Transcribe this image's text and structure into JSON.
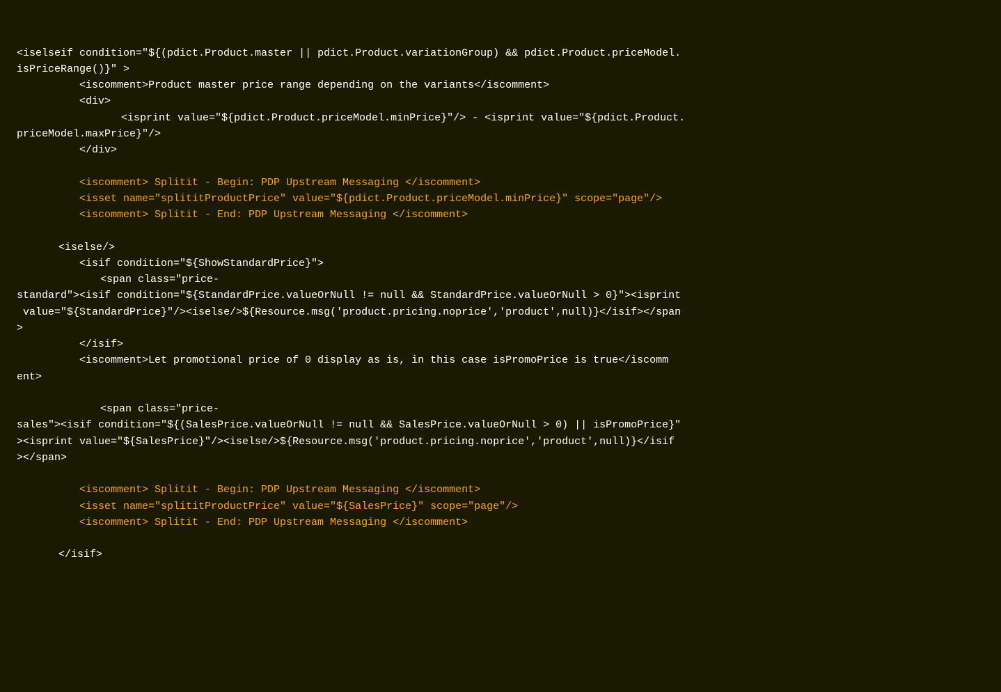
{
  "code": {
    "lines": [
      {
        "indent": 0,
        "color": "white",
        "text": "<iselseif condition=\"${(pdict.Product.master || pdict.Product.variationGroup) && pdict.Product.priceModel."
      },
      {
        "indent": 0,
        "color": "white",
        "text": "isPriceRange()}\" >"
      },
      {
        "indent": 3,
        "color": "white",
        "text": "<iscomment>Product master price range depending on the variants</iscomment>"
      },
      {
        "indent": 3,
        "color": "white",
        "text": "<div>"
      },
      {
        "indent": 5,
        "color": "white",
        "text": "<isprint value=\"${pdict.Product.priceModel.minPrice}\"/> - <isprint value=\"${pdict.Product."
      },
      {
        "indent": 0,
        "color": "white",
        "text": "priceModel.maxPrice}\"/>"
      },
      {
        "indent": 3,
        "color": "white",
        "text": "</div>"
      },
      {
        "indent": 0,
        "color": "blank",
        "text": ""
      },
      {
        "indent": 3,
        "color": "orange",
        "text": "<iscomment> Splitit - Begin: PDP Upstream Messaging </iscomment>"
      },
      {
        "indent": 3,
        "color": "orange",
        "text": "<isset name=\"splititProductPrice\" value=\"${pdict.Product.priceModel.minPrice}\" scope=\"page\"/>"
      },
      {
        "indent": 3,
        "color": "orange",
        "text": "<iscomment> Splitit - End: PDP Upstream Messaging </iscomment>"
      },
      {
        "indent": 0,
        "color": "blank",
        "text": ""
      },
      {
        "indent": 2,
        "color": "white",
        "text": "<iselse/>"
      },
      {
        "indent": 3,
        "color": "white",
        "text": "<isif condition=\"${ShowStandardPrice}\">"
      },
      {
        "indent": 4,
        "color": "white",
        "text": "<span class=\"price-"
      },
      {
        "indent": 0,
        "color": "white",
        "text": "standard\"><isif condition=\"${StandardPrice.valueOrNull != null && StandardPrice.valueOrNull > 0}\"><isprint"
      },
      {
        "indent": 0,
        "color": "white",
        "text": " value=\"${StandardPrice}\"/><iselse/>${Resource.msg('product.pricing.noprice','product',null)}</isif></span"
      },
      {
        "indent": 0,
        "color": "white",
        "text": ">"
      },
      {
        "indent": 3,
        "color": "white",
        "text": "</isif>"
      },
      {
        "indent": 3,
        "color": "white",
        "text": "<iscomment>Let promotional price of 0 display as is, in this case isPromoPrice is true</iscomm"
      },
      {
        "indent": 0,
        "color": "white",
        "text": "ent>"
      },
      {
        "indent": 0,
        "color": "blank",
        "text": ""
      },
      {
        "indent": 4,
        "color": "white",
        "text": "<span class=\"price-"
      },
      {
        "indent": 0,
        "color": "white",
        "text": "sales\"><isif condition=\"${(SalesPrice.valueOrNull != null && SalesPrice.valueOrNull > 0) || isPromoPrice}\""
      },
      {
        "indent": 0,
        "color": "white",
        "text": "><isprint value=\"${SalesPrice}\"/><iselse/>${Resource.msg('product.pricing.noprice','product',null)}</isif"
      },
      {
        "indent": 0,
        "color": "white",
        "text": "></span>"
      },
      {
        "indent": 0,
        "color": "blank",
        "text": ""
      },
      {
        "indent": 3,
        "color": "orange",
        "text": "<iscomment> Splitit - Begin: PDP Upstream Messaging </iscomment>"
      },
      {
        "indent": 3,
        "color": "orange",
        "text": "<isset name=\"splititProductPrice\" value=\"${SalesPrice}\" scope=\"page\"/>"
      },
      {
        "indent": 3,
        "color": "orange",
        "text": "<iscomment> Splitit - End: PDP Upstream Messaging </iscomment>"
      },
      {
        "indent": 0,
        "color": "blank",
        "text": ""
      },
      {
        "indent": 2,
        "color": "white",
        "text": "</isif>"
      }
    ]
  }
}
